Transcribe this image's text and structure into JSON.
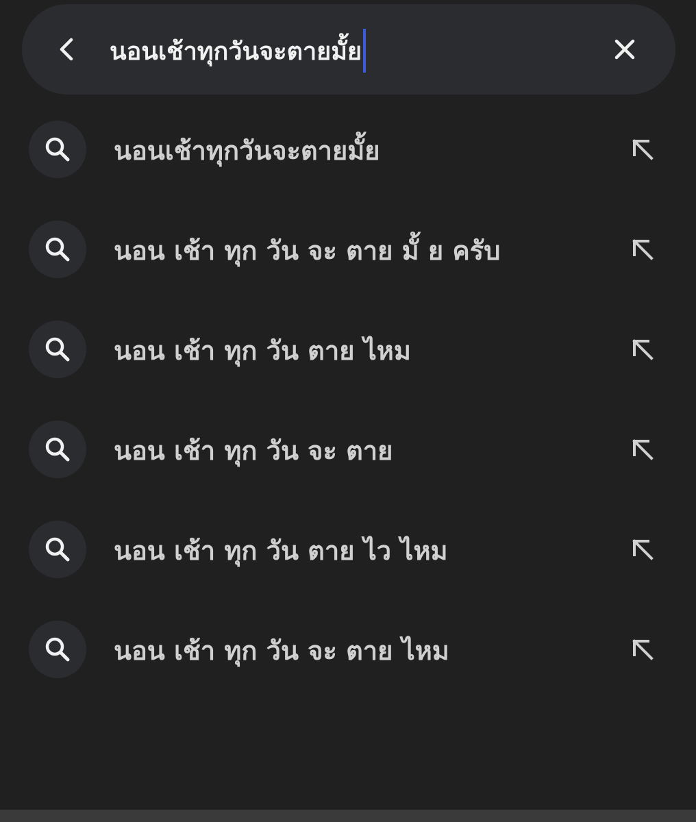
{
  "search": {
    "query": "นอนเช้าทุกวันจะตายมั้ย",
    "back_icon": "chevron-left-icon",
    "clear_icon": "close-icon"
  },
  "suggestions": [
    {
      "text": "นอนเช้าทุกวันจะตายมั้ย"
    },
    {
      "text": "นอน เช้า ทุก วัน จะ ตาย มั้ ย ครับ"
    },
    {
      "text": "นอน เช้า ทุก วัน ตาย ไหม"
    },
    {
      "text": "นอน เช้า ทุก วัน จะ ตาย"
    },
    {
      "text": "นอน เช้า ทุก วัน ตาย ไว ไหม"
    },
    {
      "text": "นอน เช้า ทุก วัน จะ ตาย ไหม"
    }
  ],
  "icons": {
    "suggestion_search": "search-icon",
    "suggestion_fill": "arrow-up-left-icon"
  },
  "colors": {
    "background": "#202020",
    "surface": "#2b2c30",
    "text_primary": "#f1f1f1",
    "text_secondary": "#d0d0d0",
    "caret": "#3b5bdb"
  }
}
